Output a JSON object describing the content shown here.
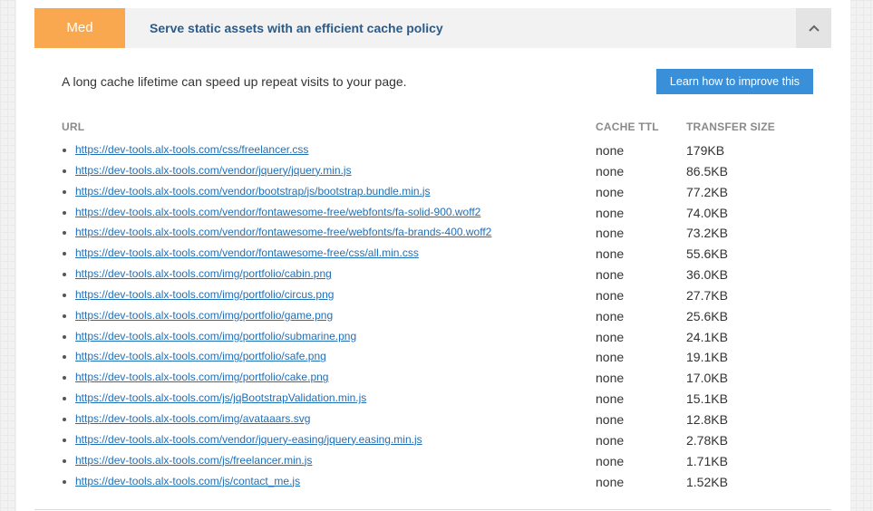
{
  "audit": {
    "severity": "Med",
    "title": "Serve static assets with an efficient cache policy",
    "collapse_icon": "chevron-up-icon",
    "description": "A long cache lifetime can speed up repeat visits to your page.",
    "learn_button": "Learn how to improve this"
  },
  "colors": {
    "badge": "#f9a84f",
    "title": "#2a5b8a",
    "link": "#1f6fb8",
    "button": "#3a8fd9"
  },
  "table": {
    "headers": {
      "url": "URL",
      "ttl": "CACHE TTL",
      "size": "TRANSFER SIZE"
    },
    "rows": [
      {
        "url": "https://dev-tools.alx-tools.com/css/freelancer.css",
        "ttl": "none",
        "size": "179KB"
      },
      {
        "url": "https://dev-tools.alx-tools.com/vendor/jquery/jquery.min.js",
        "ttl": "none",
        "size": "86.5KB"
      },
      {
        "url": "https://dev-tools.alx-tools.com/vendor/bootstrap/js/bootstrap.bundle.min.js",
        "ttl": "none",
        "size": "77.2KB"
      },
      {
        "url": "https://dev-tools.alx-tools.com/vendor/fontawesome-free/webfonts/fa-solid-900.woff2",
        "ttl": "none",
        "size": "74.0KB"
      },
      {
        "url": "https://dev-tools.alx-tools.com/vendor/fontawesome-free/webfonts/fa-brands-400.woff2",
        "ttl": "none",
        "size": "73.2KB"
      },
      {
        "url": "https://dev-tools.alx-tools.com/vendor/fontawesome-free/css/all.min.css",
        "ttl": "none",
        "size": "55.6KB"
      },
      {
        "url": "https://dev-tools.alx-tools.com/img/portfolio/cabin.png",
        "ttl": "none",
        "size": "36.0KB"
      },
      {
        "url": "https://dev-tools.alx-tools.com/img/portfolio/circus.png",
        "ttl": "none",
        "size": "27.7KB"
      },
      {
        "url": "https://dev-tools.alx-tools.com/img/portfolio/game.png",
        "ttl": "none",
        "size": "25.6KB"
      },
      {
        "url": "https://dev-tools.alx-tools.com/img/portfolio/submarine.png",
        "ttl": "none",
        "size": "24.1KB"
      },
      {
        "url": "https://dev-tools.alx-tools.com/img/portfolio/safe.png",
        "ttl": "none",
        "size": "19.1KB"
      },
      {
        "url": "https://dev-tools.alx-tools.com/img/portfolio/cake.png",
        "ttl": "none",
        "size": "17.0KB"
      },
      {
        "url": "https://dev-tools.alx-tools.com/js/jqBootstrapValidation.min.js",
        "ttl": "none",
        "size": "15.1KB"
      },
      {
        "url": "https://dev-tools.alx-tools.com/img/avataaars.svg",
        "ttl": "none",
        "size": "12.8KB"
      },
      {
        "url": "https://dev-tools.alx-tools.com/vendor/jquery-easing/jquery.easing.min.js",
        "ttl": "none",
        "size": "2.78KB"
      },
      {
        "url": "https://dev-tools.alx-tools.com/js/freelancer.min.js",
        "ttl": "none",
        "size": "1.71KB"
      },
      {
        "url": "https://dev-tools.alx-tools.com/js/contact_me.js",
        "ttl": "none",
        "size": "1.52KB"
      }
    ]
  }
}
